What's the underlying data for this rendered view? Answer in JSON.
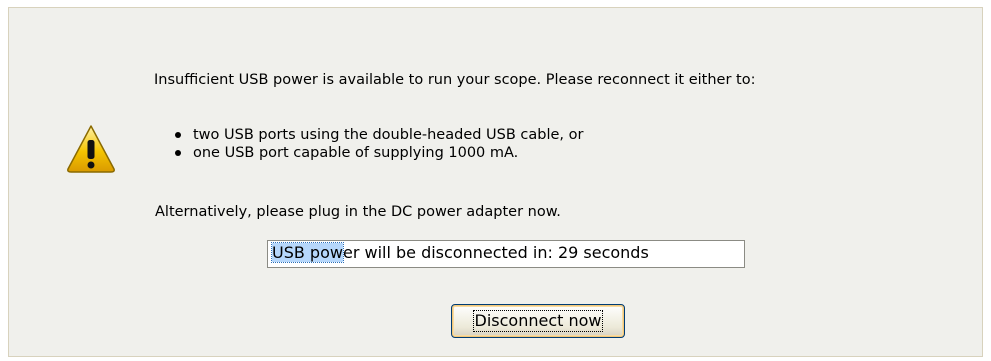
{
  "dialog": {
    "icon": "warning-icon",
    "message_line_1": "Insufficient USB power is available to run your scope. Please reconnect it either to:",
    "bullets": [
      "two USB ports using the double-headed USB cable, or",
      "one USB port capable of supplying 1000 mA."
    ],
    "message_line_2": "Alternatively, please plug in the DC power adapter now.",
    "countdown": {
      "selected_text": "USB pow",
      "remaining_text": "er will be disconnected in:  29 seconds"
    },
    "disconnect_button_label": "Disconnect now"
  },
  "colors": {
    "dialog_background": "#f0f0ec",
    "selection_highlight": "#3399ff",
    "button_border": "#003c74",
    "warning_yellow": "#f5c400"
  }
}
